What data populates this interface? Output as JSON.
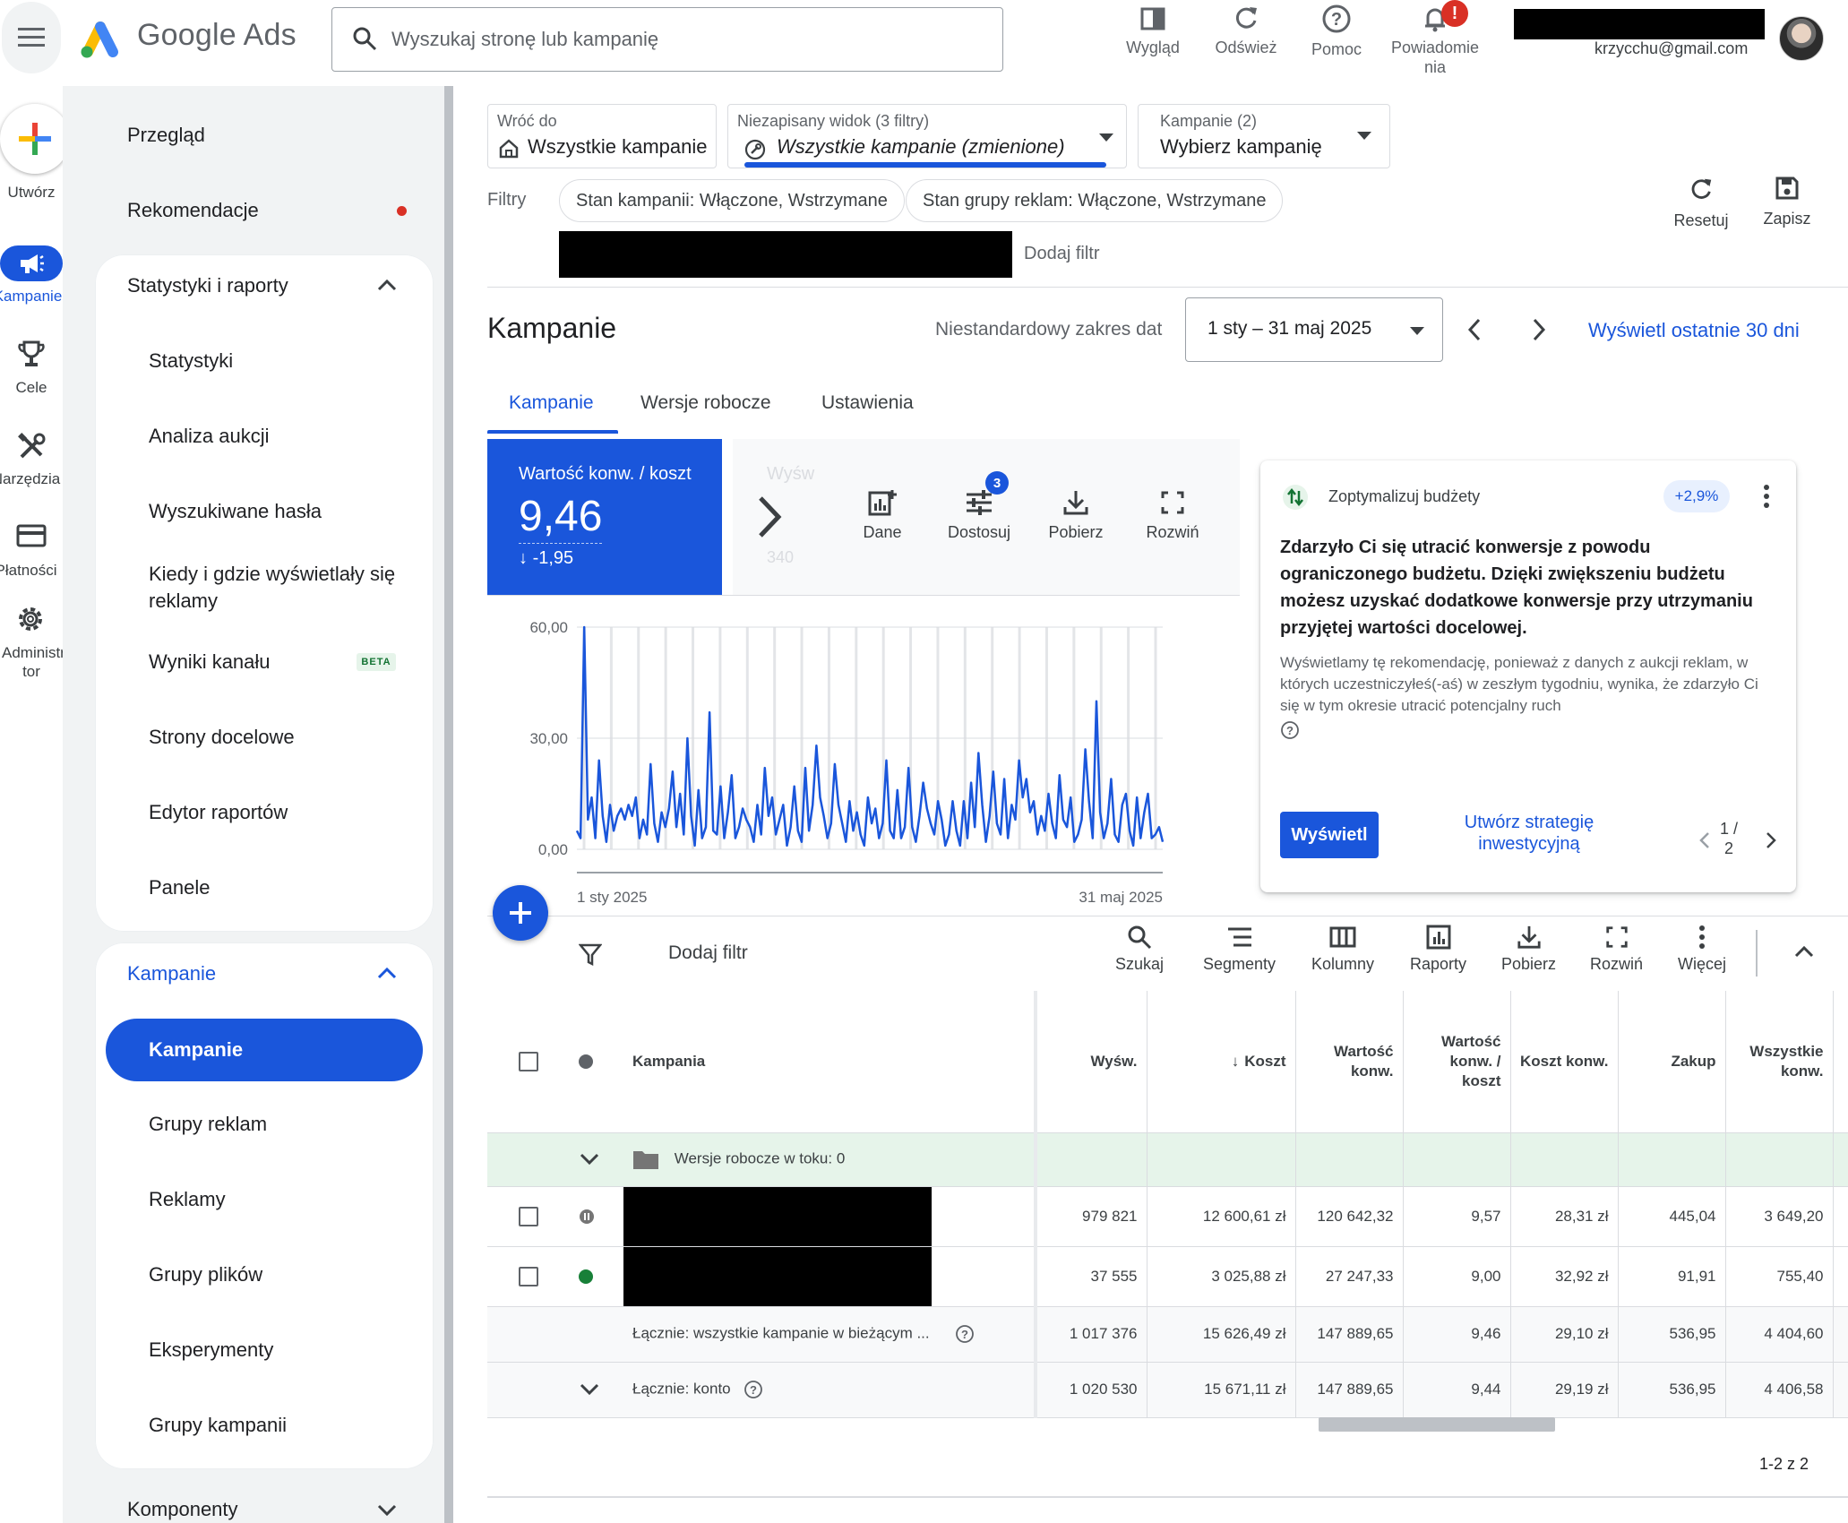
{
  "app": {
    "brand": "Google Ads",
    "search_placeholder": "Wyszukaj stronę lub kampanię",
    "email": "krzycchu@gmail.com",
    "notification_badge": "!",
    "top_actions": [
      {
        "label": "Wygląd",
        "icon": "appearance-icon"
      },
      {
        "label": "Odśwież",
        "icon": "refresh-icon"
      },
      {
        "label": "Pomoc",
        "icon": "help-icon"
      },
      {
        "label": "Powiadomie nia",
        "icon": "bell-icon"
      }
    ]
  },
  "rail": {
    "create": "Utwórz",
    "items": [
      "Kampanie",
      "Cele",
      "Narzędzia",
      "Płatności",
      "Administra tor"
    ]
  },
  "nav": {
    "overview": "Przegląd",
    "recommendations": "Rekomendacje",
    "reports_header": "Statystyki i raporty",
    "reports_items": [
      "Statystyki",
      "Analiza aukcji",
      "Wyszukiwane hasła",
      "Kiedy i gdzie wyświetlały się reklamy",
      "Wyniki kanału",
      "Strony docelowe",
      "Edytor raportów",
      "Panele"
    ],
    "beta_label": "BETA",
    "campaigns_header": "Kampanie",
    "campaigns_items": [
      "Kampanie",
      "Grupy reklam",
      "Reklamy",
      "Grupy plików",
      "Eksperymenty",
      "Grupy kampanii"
    ],
    "components_header": "Komponenty"
  },
  "selectors": {
    "back_label": "Wróć do",
    "back_value": "Wszystkie kampanie",
    "view_label": "Niezapisany widok (3 filtry)",
    "view_value": "Wszystkie kampanie (zmienione)",
    "campaign_label": "Kampanie (2)",
    "campaign_value": "Wybierz kampanię"
  },
  "filters": {
    "label": "Filtry",
    "chips": [
      "Stan kampanii: Włączone, Wstrzymane",
      "Stan grupy reklam: Włączone, Wstrzymane"
    ],
    "add_filter": "Dodaj filtr",
    "reset": "Resetuj",
    "save": "Zapisz"
  },
  "page": {
    "title": "Kampanie",
    "date_label": "Niestandardowy zakres dat",
    "date_value": "1 sty – 31 maj 2025",
    "last30_link": "Wyświetl ostatnie 30 dni",
    "tabs": [
      "Kampanie",
      "Wersje robocze",
      "Ustawienia"
    ]
  },
  "metric": {
    "label": "Wartość konw. / koszt",
    "value": "9,46",
    "delta": "-1,95",
    "ghost_label": "Wyśw",
    "ghost_delta": "340"
  },
  "chart_tools": [
    {
      "label": "Dane",
      "icon": "add-chart-icon"
    },
    {
      "label": "Dostosuj",
      "icon": "tune-icon",
      "badge": "3"
    },
    {
      "label": "Pobierz",
      "icon": "download-icon"
    },
    {
      "label": "Rozwiń",
      "icon": "fullscreen-icon"
    }
  ],
  "chart_data": {
    "type": "line",
    "series": [
      {
        "values": [
          5,
          3,
          60,
          8,
          14,
          3,
          24,
          9,
          2,
          12,
          5,
          9,
          11,
          8,
          12,
          9,
          14,
          3,
          8,
          4,
          23,
          7,
          2,
          10,
          6,
          11,
          21,
          6,
          15,
          4,
          30,
          9,
          1,
          16,
          3,
          6,
          37,
          5,
          4,
          17,
          3,
          10,
          20,
          3,
          6,
          11,
          8,
          6,
          2,
          12,
          4,
          22,
          9,
          14,
          4,
          8,
          12,
          1,
          6,
          17,
          5,
          2,
          22,
          5,
          12,
          28,
          14,
          9,
          3,
          7,
          23,
          12,
          7,
          2,
          13,
          5,
          10,
          4,
          1,
          14,
          7,
          11,
          3,
          7,
          24,
          5,
          3,
          16,
          3,
          6,
          22,
          6,
          2,
          9,
          18,
          11,
          7,
          4,
          13,
          8,
          1,
          4,
          13,
          5,
          1,
          13,
          3,
          18,
          6,
          26,
          12,
          2,
          9,
          21,
          7,
          4,
          19,
          3,
          12,
          8,
          24,
          14,
          19,
          10,
          13,
          4,
          9,
          5,
          15,
          7,
          3,
          20,
          8,
          6,
          14,
          2,
          4,
          8,
          27,
          13,
          3,
          40,
          10,
          3,
          7,
          19,
          4,
          2,
          12,
          15,
          5,
          1,
          14,
          3,
          10,
          15,
          3,
          4,
          6,
          2
        ]
      }
    ],
    "ylim": [
      0,
      60
    ],
    "yticks": [
      "60,00",
      "30,00",
      "0,00"
    ],
    "xlabels": [
      "1 sty 2025",
      "31 maj 2025"
    ],
    "color": "#1a56db"
  },
  "recommendation": {
    "title": "Zoptymalizuj budżety",
    "chip": "+2,9%",
    "headline": "Zdarzyło Ci się utracić konwersje z powodu ograniczonego budżetu. Dzięki zwiększeniu budżetu możesz uzyskać dodatkowe konwersje przy utrzymaniu przyjętej wartości docelowej.",
    "body": "Wyświetlamy tę rekomendację, ponieważ z danych z aukcji reklam, w których uczestniczyłeś(-aś) w zeszłym tygodniu, wynika, że zdarzyło Ci się w tym okresie utracić potencjalny ruch",
    "apply": "Wyświetl",
    "link": "Utwórz strategię inwestycyjną",
    "pager": "1 / 2"
  },
  "table_toolbar": {
    "add_filter": "Dodaj filtr",
    "buttons": [
      {
        "label": "Szukaj",
        "icon": "search-icon"
      },
      {
        "label": "Segmenty",
        "icon": "segments-icon"
      },
      {
        "label": "Kolumny",
        "icon": "columns-icon"
      },
      {
        "label": "Raporty",
        "icon": "reports-icon"
      },
      {
        "label": "Pobierz",
        "icon": "download-icon"
      },
      {
        "label": "Rozwiń",
        "icon": "fullscreen-icon"
      },
      {
        "label": "Więcej",
        "icon": "more-vert-icon"
      }
    ]
  },
  "table": {
    "headers": {
      "campaign": "Kampania",
      "impr": "Wyśw.",
      "cost": "Koszt",
      "conv_value": "Wartość konw.",
      "conv_value_cost": "Wartość konw. / koszt",
      "cost_conv": "Koszt konw.",
      "purchase": "Zakup",
      "all_conv": "Wszystkie konw."
    },
    "drafts": "Wersje robocze w toku: 0",
    "rows": [
      {
        "status": "paused",
        "impr": "979 821",
        "cost": "12 600,61 zł",
        "conv_value": "120 642,32",
        "conv_value_cost": "9,57",
        "cost_conv": "28,31 zł",
        "purchase": "445,04",
        "all_conv": "3 649,20"
      },
      {
        "status": "enabled",
        "impr": "37 555",
        "cost": "3 025,88 zł",
        "conv_value": "27 247,33",
        "conv_value_cost": "9,00",
        "cost_conv": "32,92 zł",
        "purchase": "91,91",
        "all_conv": "755,40"
      }
    ],
    "totals": [
      {
        "label": "Łącznie: wszystkie kampanie w bieżącym ...",
        "impr": "1 017 376",
        "cost": "15 626,49 zł",
        "conv_value": "147 889,65",
        "conv_value_cost": "9,46",
        "cost_conv": "29,10 zł",
        "purchase": "536,95",
        "all_conv": "4 404,60"
      },
      {
        "label": "Łącznie: konto",
        "impr": "1 020 530",
        "cost": "15 671,11 zł",
        "conv_value": "147 889,65",
        "conv_value_cost": "9,44",
        "cost_conv": "29,19 zł",
        "purchase": "536,95",
        "all_conv": "4 406,58"
      }
    ],
    "pagination": "1-2 z 2"
  }
}
